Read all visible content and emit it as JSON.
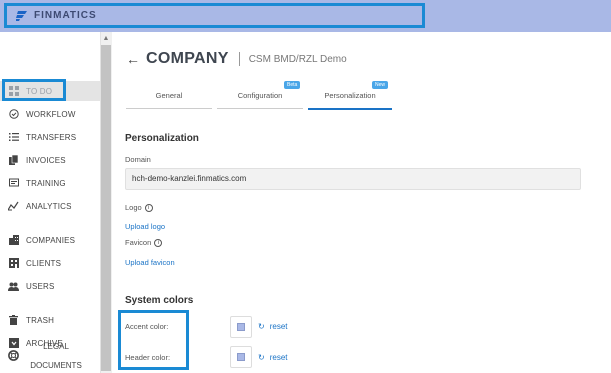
{
  "brand": {
    "name": "FINMATICS",
    "accent": "#a9b8e6",
    "highlight": "#1a8ad4"
  },
  "sidebar": {
    "items": [
      {
        "label": "TO DO",
        "icon": "todo-grid-icon"
      },
      {
        "label": "WORKFLOW",
        "icon": "check-circle-icon"
      },
      {
        "label": "TRANSFERS",
        "icon": "list-icon"
      },
      {
        "label": "INVOICES",
        "icon": "invoice-icon"
      },
      {
        "label": "TRAINING",
        "icon": "training-icon"
      },
      {
        "label": "ANALYTICS",
        "icon": "analytics-icon"
      },
      {
        "label": "COMPANIES",
        "icon": "building-icon"
      },
      {
        "label": "CLIENTS",
        "icon": "clients-icon"
      },
      {
        "label": "USERS",
        "icon": "users-icon"
      },
      {
        "label": "TRASH",
        "icon": "trash-icon"
      },
      {
        "label": "ARCHIVE",
        "icon": "archive-icon"
      }
    ],
    "legal_line1": "LEGAL",
    "legal_line2": "DOCUMENTS"
  },
  "header": {
    "title": "COMPANY",
    "subtitle": "CSM BMD/RZL Demo"
  },
  "tabs": [
    {
      "label": "General"
    },
    {
      "label": "Configuration",
      "badge": "Beta"
    },
    {
      "label": "Personalization",
      "badge": "New"
    }
  ],
  "personalization": {
    "title": "Personalization",
    "domain_label": "Domain",
    "domain_value": "hch-demo-kanzlei.finmatics.com",
    "logo_label": "Logo",
    "upload_logo": "Upload logo",
    "favicon_label": "Favicon",
    "upload_favicon": "Upload favicon"
  },
  "system_colors": {
    "title": "System colors",
    "accent_label": "Accent color:",
    "header_label": "Header color:",
    "reset_label": "reset"
  }
}
